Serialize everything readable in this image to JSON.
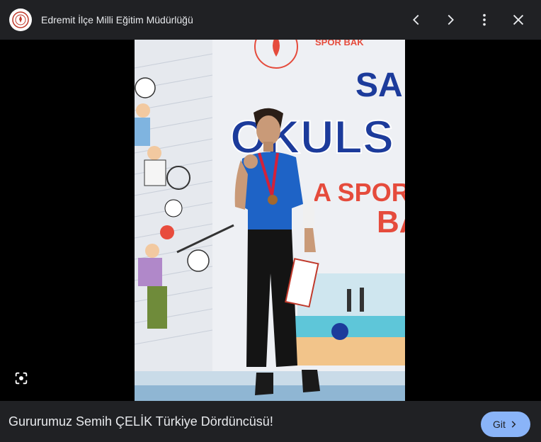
{
  "header": {
    "site_name": "Edremit İlçe Milli Eğitim Müdürlüğü",
    "logo_icon": "ministry-emblem-icon",
    "actions": [
      "previous-icon",
      "next-icon",
      "more-icon",
      "close-icon"
    ]
  },
  "image": {
    "banner_text_top": "SPOR BAK",
    "banner_text_mid": "OKULS",
    "banner_text_bottom": "A SPORL",
    "banner_text_sa": "SA",
    "banner_text_ba": "BA"
  },
  "footer": {
    "caption": "Gururumuz Semih ÇELİK Türkiye Dördüncüsü!",
    "go_label": "Git"
  },
  "colors": {
    "bar_bg": "#202124",
    "accent": "#8ab4f8",
    "text": "#e8eaed"
  }
}
